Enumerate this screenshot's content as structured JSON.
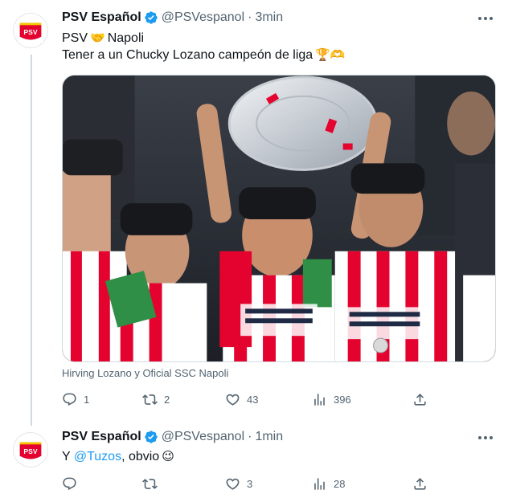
{
  "tweets": [
    {
      "author": "PSV Español",
      "handle": "@PSVespanol",
      "separator": "·",
      "time": "3min",
      "line1": {
        "before": "PSV",
        "emoji": "🤝",
        "after": "Napoli"
      },
      "line2": {
        "text": "Tener a un Chucky Lozano campeón de liga",
        "emojis": "🏆🫶"
      },
      "media_caption": "Hirving Lozano y Oficial SSC Napoli",
      "stats": {
        "replies": "1",
        "retweets": "2",
        "likes": "43",
        "views": "396"
      }
    },
    {
      "author": "PSV Español",
      "handle": "@PSVespanol",
      "separator": "·",
      "time": "1min",
      "text": {
        "before": "Y",
        "mention": "@Tuzos",
        "after": ", obvio",
        "emoji": "😉"
      },
      "stats": {
        "replies": "",
        "retweets": "",
        "likes": "3",
        "views": "28"
      }
    }
  ],
  "avatar_text": "PSV",
  "colors": {
    "verified": "#1d9bf0",
    "psv_red": "#e4032e",
    "text_secondary": "#536471",
    "link": "#1d9bf0"
  },
  "icons": [
    "psv-logo-icon",
    "verified-badge-icon",
    "more-icon",
    "reply-icon",
    "retweet-icon",
    "like-icon",
    "views-icon",
    "share-icon"
  ]
}
